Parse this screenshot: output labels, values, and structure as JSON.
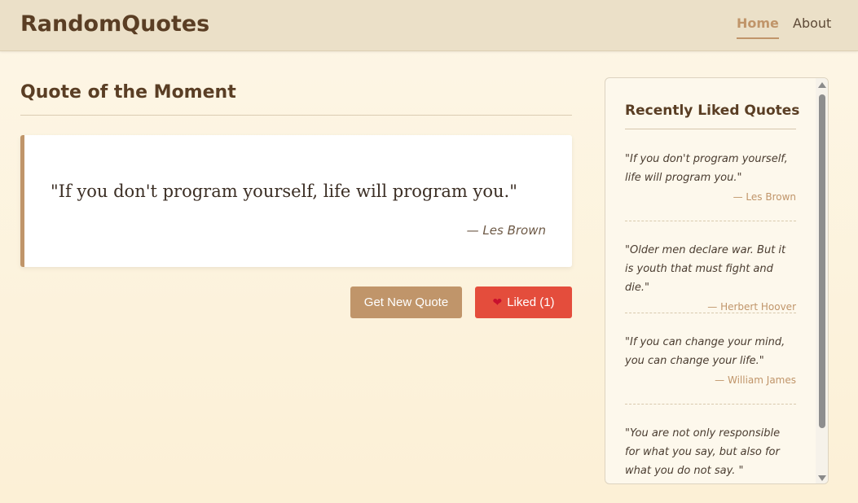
{
  "header": {
    "logo": "RandomQuotes",
    "nav": [
      {
        "label": "Home",
        "active": true
      },
      {
        "label": "About",
        "active": false
      }
    ]
  },
  "main": {
    "section_title": "Quote of the Moment",
    "quote": {
      "text": "\"If you don't program yourself, life will program you.\"",
      "author": "— Les Brown"
    },
    "buttons": {
      "new_quote": "Get New Quote",
      "liked": "Liked (1)",
      "liked_icon": "heart-icon"
    }
  },
  "sidebar": {
    "title": "Recently Liked Quotes",
    "items": [
      {
        "text": "\"If you don't program yourself, life will program you.\"",
        "author": "— Les Brown"
      },
      {
        "text": "\"Older men declare war. But it is youth that must fight and die.\"",
        "author": "— Herbert Hoover"
      },
      {
        "text": "\"If you can change your mind, you can change your life.\"",
        "author": "— William James"
      },
      {
        "text": "\"You are not only responsible for what you say, but also for what you do not say. \"",
        "author": ""
      }
    ]
  },
  "colors": {
    "accent": "#c0956a",
    "like_button": "#e44d3c",
    "header_bg": "#ebe0c8"
  }
}
